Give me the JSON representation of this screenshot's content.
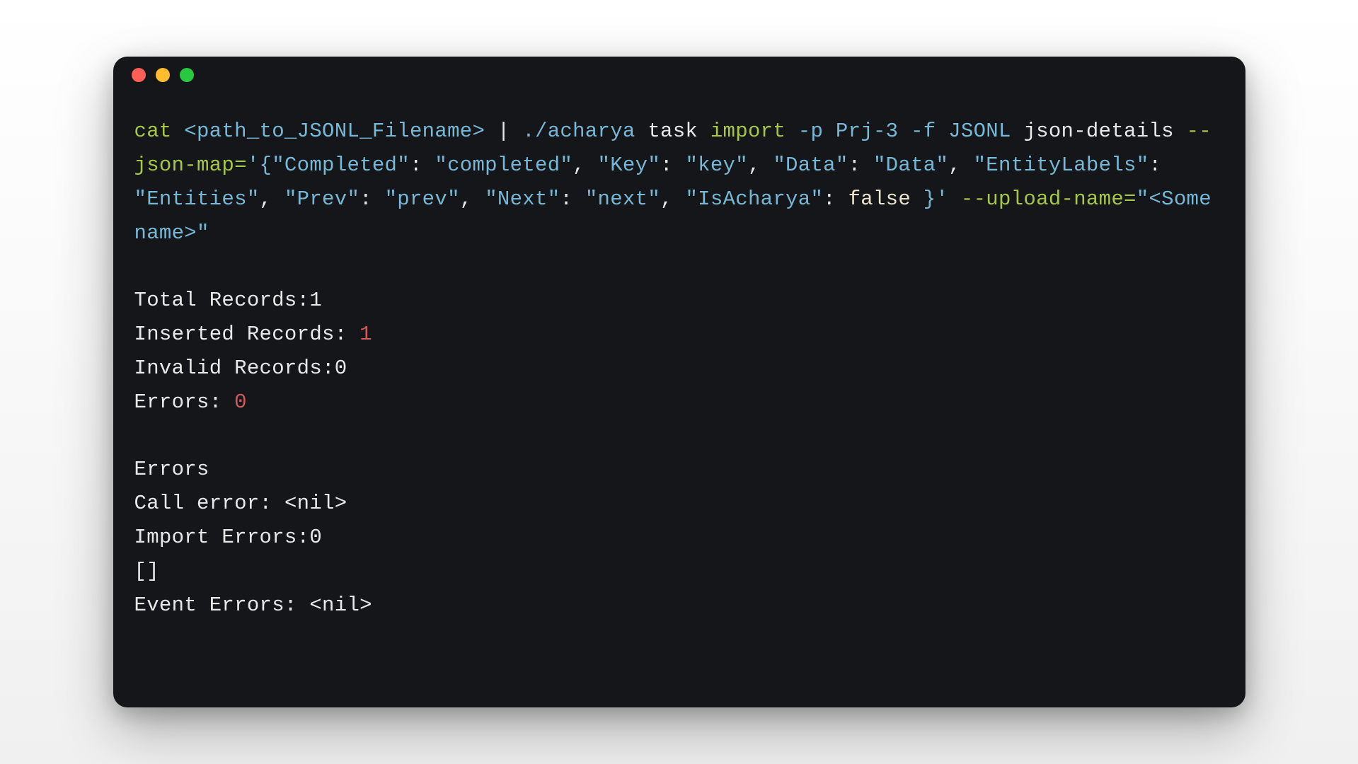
{
  "command": {
    "cat": "cat",
    "path": "<path_to_JSONL_Filename>",
    "pipe": " | ",
    "executable": "./acharya",
    "task": " task ",
    "import_word": "import",
    "flag_p": " -p",
    "project": " Prj-3",
    "flag_f": " -f",
    "format": " JSONL",
    "json_details": "json-details ",
    "json_map_flag": "--json-map=",
    "json_map_open": "'{",
    "kv_completed_k": "\"Completed\"",
    "kv_completed_v": "\"completed\"",
    "kv_key_k": "\"Key\"",
    "kv_key_v": "\"key\"",
    "kv_data_k": "\"Data\"",
    "kv_data_v": "\"Data\"",
    "kv_entity_k": "\"EntityLabels\"",
    "kv_entity_v": "\"Entities\"",
    "kv_prev_k": "\"Prev\"",
    "kv_prev_v": "\"prev\"",
    "kv_next_k": "\"Next\"",
    "kv_next_v": "\"next\"",
    "kv_isacharya_k": "\"IsAcharya\"",
    "kv_isacharya_v": "false",
    "json_map_close": " }' ",
    "upload_name_flag": "--upload-name=",
    "upload_name_val": "\"<Some name>\"",
    "colon_sp": ": ",
    "comma_sp": ", "
  },
  "output": {
    "total_records_label": "Total Records:",
    "total_records_value": "1",
    "inserted_records_label": "Inserted Records: ",
    "inserted_records_value": "1",
    "invalid_records_label": "Invalid Records:",
    "invalid_records_value": "0",
    "errors_label": "Errors: ",
    "errors_value": "0",
    "errors_header": "Errors",
    "call_error_label": "Call error: ",
    "call_error_value": "<nil>",
    "import_errors_label": "Import Errors:",
    "import_errors_value": "0",
    "empty_array": "[]",
    "event_errors_label": "Event Errors: ",
    "event_errors_value": "<nil>"
  }
}
